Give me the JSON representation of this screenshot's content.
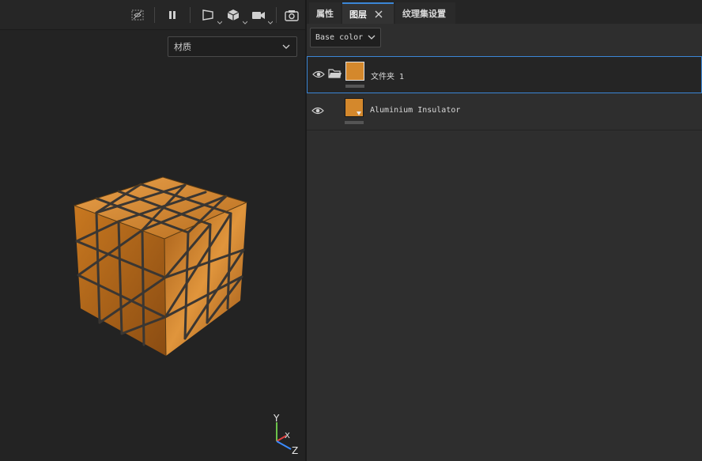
{
  "viewport": {
    "toolbar_icons": [
      "hide-icon",
      "pause-icon",
      "perspective-icon",
      "cube-view-icon",
      "camera-icon",
      "screenshot-icon"
    ],
    "material_select": {
      "value": "材质"
    },
    "axis": {
      "y": "Y",
      "x": "X",
      "z": "Z"
    },
    "colors": {
      "material": "#c97a26",
      "grout": "#3a3632"
    }
  },
  "panel": {
    "tabs": [
      {
        "label": "属性"
      },
      {
        "label": "图层"
      },
      {
        "label": "纹理集设置"
      }
    ],
    "channel_select": {
      "value": "Base color"
    },
    "layers": [
      {
        "name": "文件夹 1",
        "type": "folder",
        "selected": true
      },
      {
        "name": "Aluminium Insulator",
        "type": "material",
        "selected": false
      }
    ],
    "accent": "#3b86d6"
  }
}
